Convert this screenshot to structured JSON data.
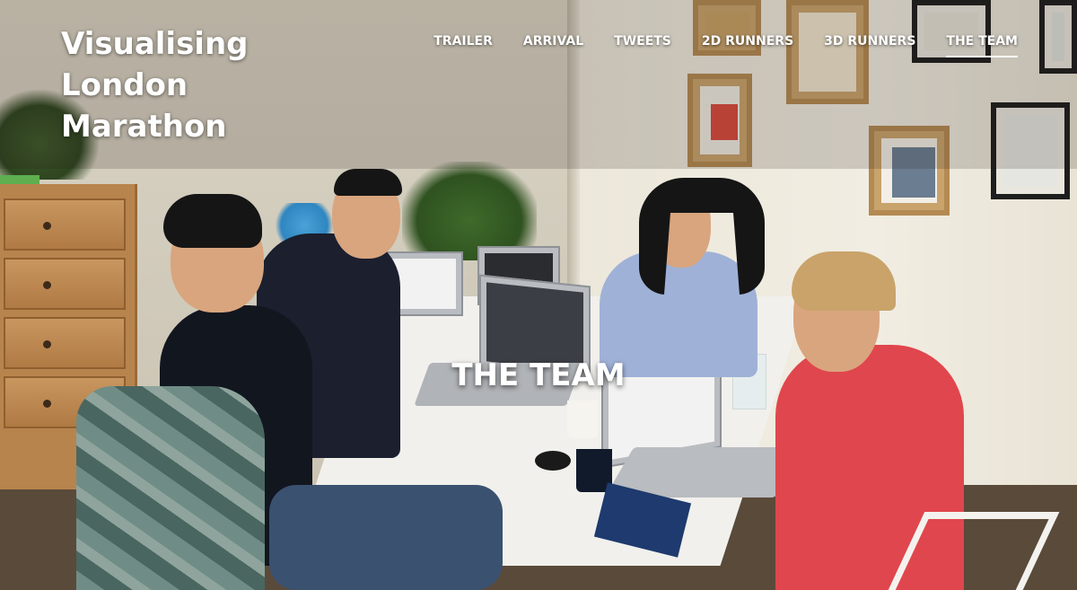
{
  "site": {
    "title_lines": [
      "Visualising",
      "London",
      "Marathon"
    ]
  },
  "nav": {
    "items": [
      {
        "label": "TRAILER",
        "active": false
      },
      {
        "label": "ARRIVAL",
        "active": false
      },
      {
        "label": "TWEETS",
        "active": false
      },
      {
        "label": "2D RUNNERS",
        "active": false
      },
      {
        "label": "3D RUNNERS",
        "active": false
      },
      {
        "label": "THE TEAM",
        "active": true
      }
    ]
  },
  "hero": {
    "heading": "THE TEAM"
  },
  "colors": {
    "text": "#ffffff",
    "header_overlay": "rgba(40,30,20,0.18)",
    "hoodie": "#e0464d"
  }
}
